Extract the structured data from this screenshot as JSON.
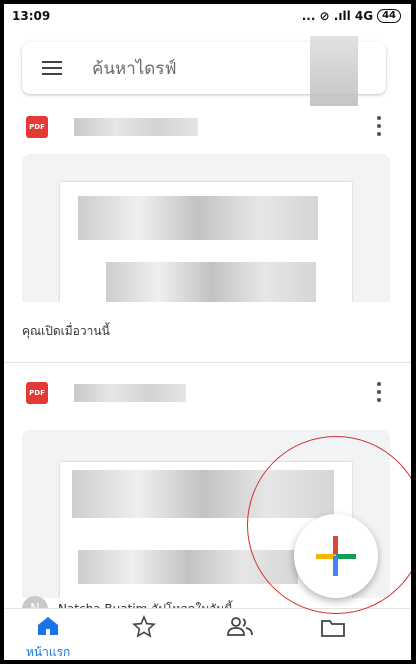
{
  "status_bar": {
    "time": "13:09",
    "signal": "... ⊘ .ıll 4G",
    "battery": "44"
  },
  "search": {
    "placeholder": "ค้นหาไดรฟ์"
  },
  "files": [
    {
      "type_badge": "PDF",
      "activity": "คุณเปิดเมื่อวานนี้"
    },
    {
      "type_badge": "PDF",
      "activity": "Natcha Buatim อัปโหลดในวันนี้",
      "owner_initial": "N"
    }
  ],
  "fab": {
    "icon": "plus-icon",
    "colors": [
      "#db4437",
      "#f4b400",
      "#0f9d58",
      "#4285f4"
    ]
  },
  "bottom_nav": {
    "items": [
      {
        "label": "หน้าแรก",
        "icon": "home-icon",
        "active": true
      },
      {
        "label": "",
        "icon": "star-icon"
      },
      {
        "label": "",
        "icon": "people-icon"
      },
      {
        "label": "",
        "icon": "folder-icon"
      }
    ],
    "active_color": "#1a73e8"
  }
}
